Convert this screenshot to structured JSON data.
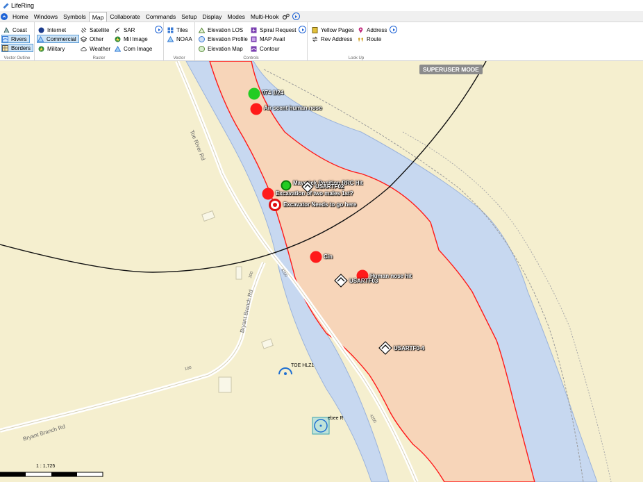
{
  "window": {
    "title": "LifeRing"
  },
  "menu": {
    "items": [
      "Home",
      "Windows",
      "Symbols",
      "Map",
      "Collaborate",
      "Commands",
      "Setup",
      "Display",
      "Modes",
      "Multi-Hook"
    ],
    "active": "Map"
  },
  "ribbon": {
    "vector_outline": {
      "label": "Vector Outline",
      "items": [
        "Coast",
        "Rivers",
        "Borders"
      ]
    },
    "raster": {
      "label": "Raster",
      "col1": [
        "Internet",
        "Commercial",
        "Military"
      ],
      "col2": [
        "Satellite",
        "Other",
        "Weather"
      ],
      "col3": [
        "SAR",
        "Mil Image",
        "Com Image"
      ]
    },
    "vector": {
      "label": "Vector",
      "items": [
        "Tiles",
        "NOAA"
      ]
    },
    "controls": {
      "label": "Controls",
      "col1": [
        "Elevation LOS",
        "Elevation Profile",
        "Elevation Map"
      ],
      "col2": [
        "Spiral Request",
        "MAP Avail",
        "Contour"
      ]
    },
    "lookup": {
      "label": "Look Up",
      "col1": [
        "Yellow Pages",
        "Rev Address"
      ],
      "col2": [
        "Address",
        "Route"
      ]
    }
  },
  "map": {
    "mode_badge": "SUPERUSER MODE",
    "markers": {
      "green_top": "074 1/24",
      "red_1": "Air scent human nose",
      "green_mid": "Maverick Position RRC Hit",
      "vehicle_1": "USARTF02",
      "red_2": "Excavation of two males 1st?",
      "target": "Excavator Needs to go here",
      "red_3": "Cin",
      "red_4": "Human nose hit",
      "vehicle_2": "USARTF03",
      "vehicle_3": "USARTF0-4",
      "hlz": "TOE HLZ1",
      "beacon": "ebee R"
    },
    "roads": {
      "toe_river": "Toe River Rd",
      "bryant_1": "Bryant Branch Rd",
      "bryant_2": "Bryant Branch Rd",
      "n1": "4200",
      "n2": "100",
      "n3": "4200",
      "n4": "100"
    },
    "scale": "1 : 1,725"
  },
  "colors": {
    "search_area": "#f7d5b9",
    "river": "#c7d8f0",
    "land": "#f5efcf",
    "red": "#ff1a1a",
    "green": "#22cc22"
  }
}
